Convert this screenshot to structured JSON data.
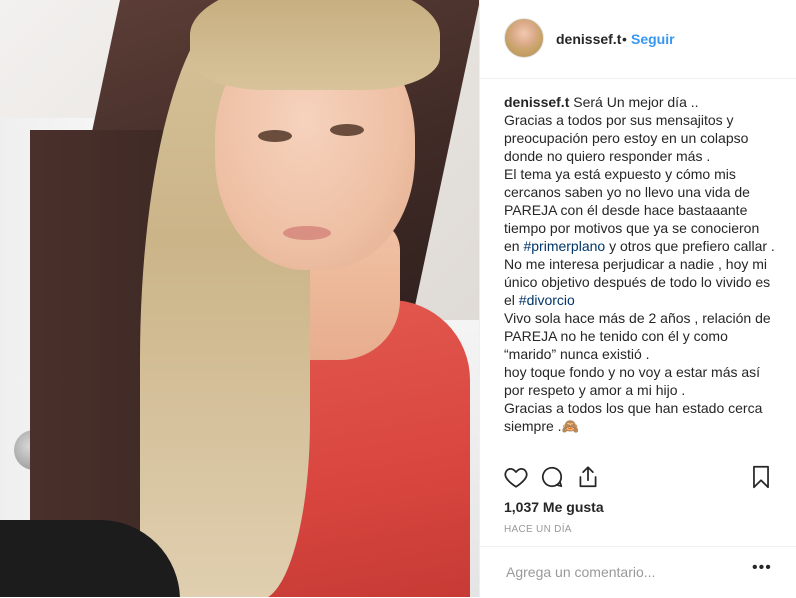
{
  "post": {
    "username": "denissef.t",
    "separator": "•",
    "follow_label": "Seguir"
  },
  "caption": {
    "username": "denissef.t",
    "segments": [
      {
        "text": " Será Un mejor día ..\nGracias a todos por sus mensajitos y preocupación pero estoy en un colapso donde no quiero responder más .\nEl tema ya está expuesto y cómo mis cercanos saben yo no llevo una vida de PAREJA con él desde hace bastaaante tiempo por motivos que ya se conocieron en ",
        "tag": false
      },
      {
        "text": "#primerplano",
        "tag": true
      },
      {
        "text": " y otros que prefiero callar .\nNo me interesa perjudicar a nadie , hoy mi único objetivo después de todo lo vivido es el ",
        "tag": false
      },
      {
        "text": "#divorcio",
        "tag": true
      },
      {
        "text": "\nVivo sola hace más de 2 años , relación de PAREJA no he tenido con él y como “marido” nunca existió .\nhoy toque fondo y no voy a estar más así por respeto y amor a mi hijo .\nGracias a todos los que han estado cerca siempre .🙈",
        "tag": false
      }
    ]
  },
  "actions": {
    "like_icon": "heart-icon",
    "comment_icon": "comment-icon",
    "share_icon": "share-icon",
    "save_icon": "bookmark-icon"
  },
  "likes_text": "1,037 Me gusta",
  "timestamp": "HACE UN DÍA",
  "comment": {
    "placeholder": "Agrega un comentario...",
    "more_label": "•••"
  }
}
